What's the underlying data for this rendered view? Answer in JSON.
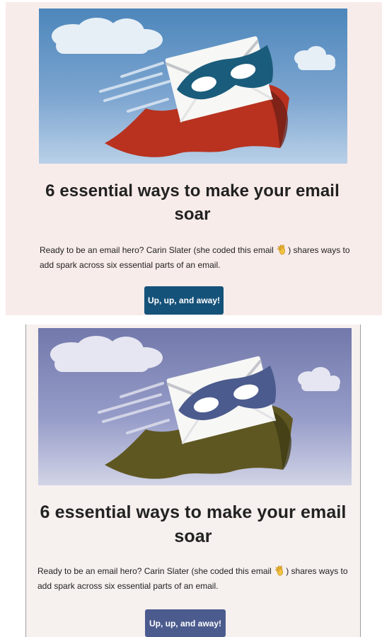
{
  "colors": {
    "panel_1_background": "#f8ecea",
    "panel_2_background": "#f6f0ee",
    "panel_1_button": "#15527a",
    "panel_2_button": "#4b5b8e",
    "text": "#222222",
    "panel_1_mask": "#1a5c7b",
    "panel_2_mask": "#4b5b8e",
    "panel_1_cape": "#b8321f",
    "panel_2_cape": "#5f5722"
  },
  "icons": {
    "hero_illustration": "flying-email-hero-illustration",
    "wave_emoji": "waving-hand-emoji"
  },
  "panels": [
    {
      "headline": "6 essential ways to make your email soar",
      "body_text_before": "Ready to be an email hero? Carin Slater (she coded this email ",
      "body_text_after": ") shares ways to add spark across six essential parts of an email.",
      "button_label": "Up, up, and away!"
    },
    {
      "headline": "6 essential ways to make your email soar",
      "body_text_before": "Ready to be an email hero? Carin Slater (she coded this email ",
      "body_text_after": ") shares ways to add spark across six essential parts of an email.",
      "button_label": "Up, up, and away!"
    }
  ]
}
